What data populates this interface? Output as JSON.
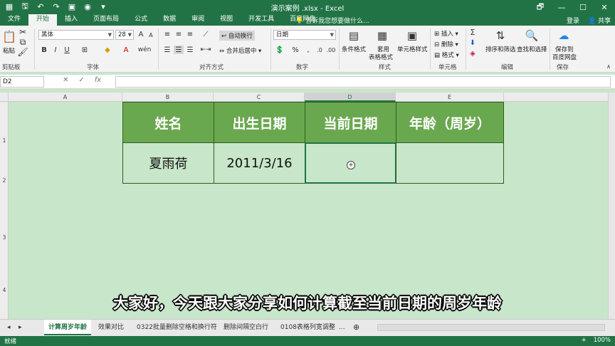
{
  "window": {
    "title": "演示案例 .xlsx - Excel",
    "buttons": [
      "🗗",
      "—",
      "☐",
      "✕"
    ]
  },
  "qat": {
    "icons": [
      "excel-icon",
      "save-icon",
      "undo-icon",
      "redo-icon",
      "export-icon",
      "camera-icon",
      "customize-icon"
    ],
    "glyphs": [
      "▦",
      "🖫",
      "↶",
      "↷",
      "▣",
      "◉",
      "▾"
    ]
  },
  "tabs": [
    "文件",
    "开始",
    "插入",
    "页面布局",
    "公式",
    "数据",
    "审阅",
    "视图",
    "开发工具",
    "百度网盘"
  ],
  "tell_me": "告诉我您想要做什么...",
  "account": {
    "login": "登录",
    "share": "共享"
  },
  "ribbon": {
    "clipboard": {
      "label": "剪贴板",
      "paste": "粘贴"
    },
    "font": {
      "label": "字体",
      "name": "黑体",
      "size": "28"
    },
    "alignment": {
      "label": "对齐方式",
      "wrap": "自动换行",
      "merge": "合并后居中"
    },
    "number": {
      "label": "数字",
      "format": "日期"
    },
    "styles": {
      "label": "样式",
      "conditional": "条件格式",
      "table_fmt_1": "套用",
      "table_fmt_2": "表格格式",
      "cell_styles": "单元格样式"
    },
    "cells": {
      "label": "单元格",
      "insert": "插入",
      "delete": "删除",
      "format": "格式"
    },
    "editing": {
      "label": "编辑",
      "sort": "排序和筛选",
      "find": "查找和选择"
    },
    "save": {
      "label": "保存",
      "save_1": "保存到",
      "save_2": "百度网盘"
    }
  },
  "formula_bar": {
    "name_box": "D2",
    "cancel": "✕",
    "confirm": "✓",
    "fx": "fx",
    "value": ""
  },
  "columns": [
    "A",
    "B",
    "C",
    "D",
    "E"
  ],
  "rows": [
    "1",
    "2",
    "3",
    "4"
  ],
  "table": {
    "headers": [
      "姓名",
      "出生日期",
      "当前日期",
      "年龄（周岁）"
    ],
    "row": [
      "夏雨荷",
      "2011/3/16",
      "",
      ""
    ]
  },
  "subtitle": "大家好，今天跟大家分享如何计算截至当前日期的周岁年龄",
  "sheet_tabs": [
    "计算周岁年龄",
    "效果对比",
    "0322批量删除空格和换行符",
    "删除间隔空白行",
    "0108表格列宽调整"
  ],
  "sheet_nav": {
    "more": "...",
    "add": "⊕",
    "next": "▸"
  },
  "status": {
    "left": "就绪",
    "zoom": "+",
    "zoom_value": "100%"
  },
  "colors": {
    "brand": "#217346",
    "header_fill": "#6aa84f",
    "sheet_bg": "#c8e6c9"
  }
}
